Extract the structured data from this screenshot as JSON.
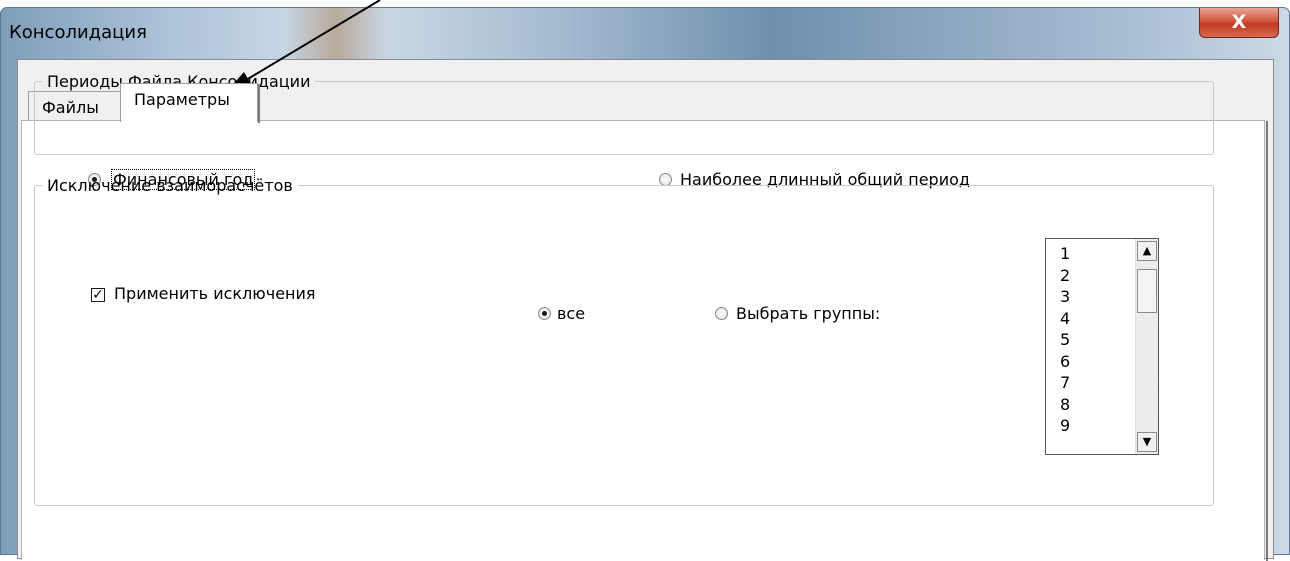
{
  "window": {
    "title": "Консолидация",
    "close_label": "X"
  },
  "tabs": [
    {
      "label": "Файлы"
    },
    {
      "label": "Параметры"
    }
  ],
  "periods": {
    "legend": "Периоды Файла Консолидации",
    "option_fiscal": "Финансовый год",
    "option_longest": "Наиболее длинный общий период",
    "selected": "fiscal"
  },
  "elimination": {
    "legend": "Исключение взаиморасчётов",
    "apply_label": "Применить исключения",
    "apply_checked": true,
    "option_all": "все",
    "option_groups": "Выбрать группы:",
    "selected": "all",
    "groups": [
      "1",
      "2",
      "3",
      "4",
      "5",
      "6",
      "7",
      "8",
      "9"
    ]
  },
  "icons": {
    "close": "close-icon",
    "scroll_up": "scroll-up-arrow-icon",
    "scroll_down": "scroll-down-arrow-icon",
    "annotation": "annotation-arrow-icon"
  }
}
